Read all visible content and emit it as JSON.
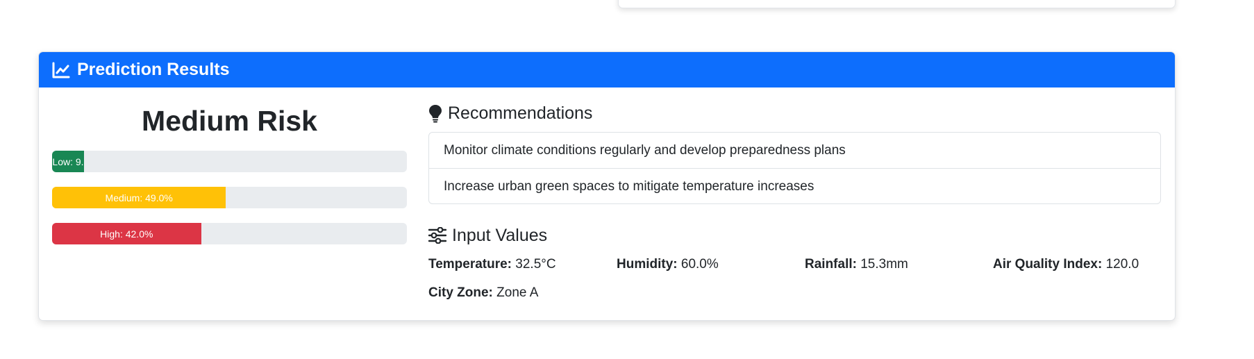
{
  "header": {
    "title": "Prediction Results",
    "icon": "chart-line-icon",
    "color": "#0d6efd"
  },
  "risk": {
    "label": "Medium Risk",
    "bars": {
      "low": {
        "label": "Low: 9.",
        "percent": 9.0,
        "color": "#198754"
      },
      "medium": {
        "label": "Medium: 49.0%",
        "percent": 49.0,
        "color": "#ffc107"
      },
      "high": {
        "label": "High: 42.0%",
        "percent": 42.0,
        "color": "#dc3545"
      }
    }
  },
  "recommendations": {
    "title": "Recommendations",
    "icon": "lightbulb-icon",
    "items": [
      "Monitor climate conditions regularly and develop preparedness plans",
      "Increase urban green spaces to mitigate temperature increases"
    ]
  },
  "inputs": {
    "title": "Input Values",
    "icon": "sliders-icon",
    "temperature": {
      "label": "Temperature:",
      "value": "32.5°C"
    },
    "humidity": {
      "label": "Humidity:",
      "value": "60.0%"
    },
    "rainfall": {
      "label": "Rainfall:",
      "value": "15.3mm"
    },
    "aqi": {
      "label": "Air Quality Index:",
      "value": "120.0"
    },
    "zone": {
      "label": "City Zone:",
      "value": "Zone A"
    }
  }
}
